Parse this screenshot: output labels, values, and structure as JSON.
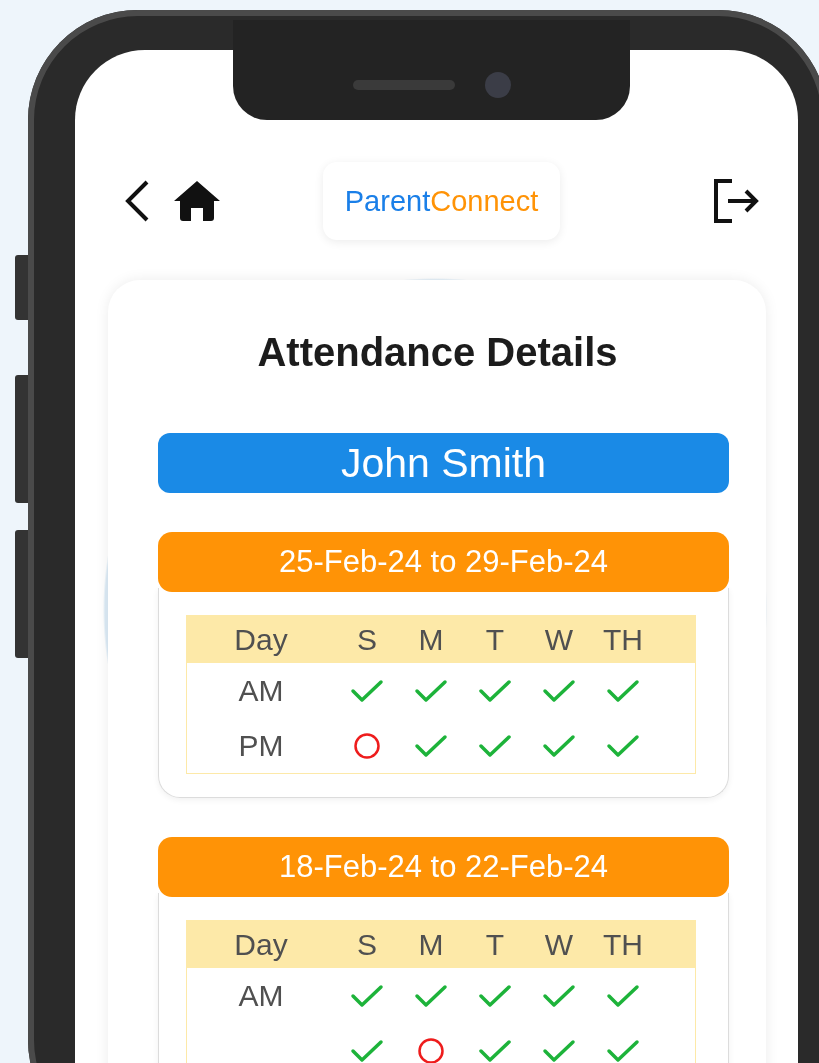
{
  "header": {
    "logo": {
      "first": "Parent",
      "second": "Connect"
    }
  },
  "title": "Attendance Details",
  "student": "John Smith",
  "weeks": [
    {
      "range": "25-Feb-24 to 29-Feb-24",
      "columns": [
        "Day",
        "S",
        "M",
        "T",
        "W",
        "TH"
      ],
      "rows": [
        {
          "label": "AM",
          "present": [
            true,
            true,
            true,
            true,
            true
          ]
        },
        {
          "label": "PM",
          "present": [
            false,
            true,
            true,
            true,
            true
          ]
        }
      ]
    },
    {
      "range": "18-Feb-24 to 22-Feb-24",
      "columns": [
        "Day",
        "S",
        "M",
        "T",
        "W",
        "TH"
      ],
      "rows": [
        {
          "label": "AM",
          "present": [
            true,
            true,
            true,
            true,
            true
          ]
        },
        {
          "present": [
            true,
            false,
            true,
            true,
            true
          ]
        }
      ]
    }
  ]
}
